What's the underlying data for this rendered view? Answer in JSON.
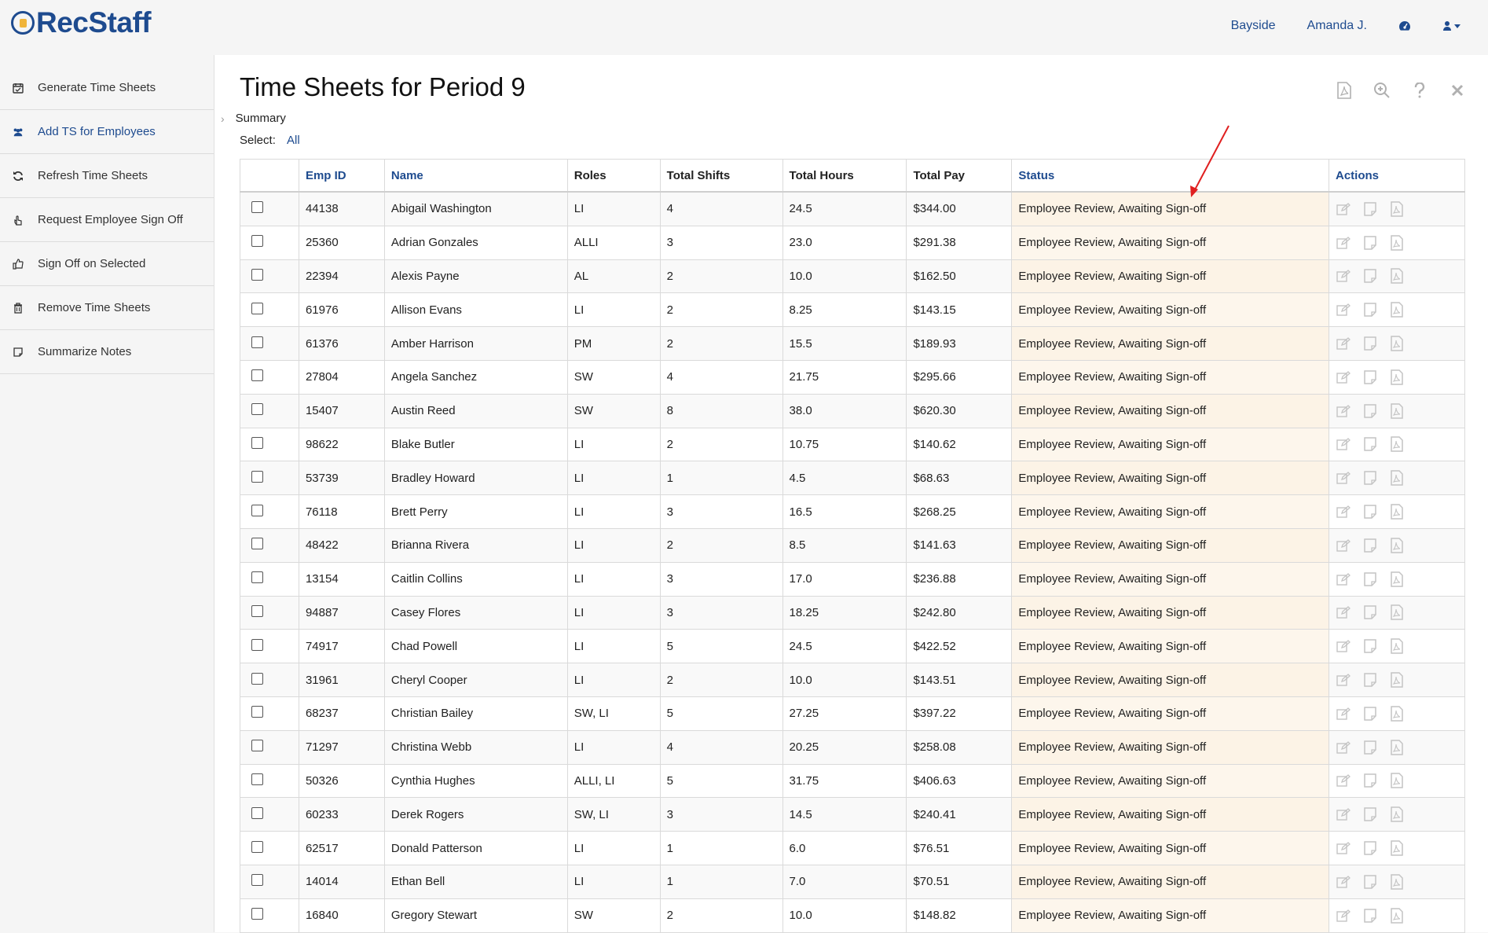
{
  "app": {
    "name": "RecStaff"
  },
  "topnav": {
    "location": "Bayside",
    "user": "Amanda J.",
    "dashboard_icon": "dashboard-icon",
    "user_icon": "user-icon"
  },
  "sidebar": {
    "items": [
      {
        "label": "Generate Time Sheets",
        "icon": "calendar-check-icon",
        "active": false
      },
      {
        "label": "Add TS for Employees",
        "icon": "users-icon",
        "active": true
      },
      {
        "label": "Refresh Time Sheets",
        "icon": "refresh-icon",
        "active": false
      },
      {
        "label": "Request Employee Sign Off",
        "icon": "hand-pointer-icon",
        "active": false
      },
      {
        "label": "Sign Off on Selected",
        "icon": "thumbs-up-icon",
        "active": false
      },
      {
        "label": "Remove Time Sheets",
        "icon": "trash-icon",
        "active": false
      },
      {
        "label": "Summarize Notes",
        "icon": "note-icon",
        "active": false
      }
    ]
  },
  "main": {
    "title": "Time Sheets for Period 9",
    "summary_label": "Summary",
    "select_label": "Select:",
    "select_all": "All"
  },
  "table": {
    "headers": {
      "emp_id": "Emp ID",
      "name": "Name",
      "roles": "Roles",
      "total_shifts": "Total Shifts",
      "total_hours": "Total Hours",
      "total_pay": "Total Pay",
      "status": "Status",
      "actions": "Actions"
    },
    "rows": [
      {
        "emp_id": "44138",
        "name": "Abigail Washington",
        "roles": "LI",
        "shifts": "4",
        "hours": "24.5",
        "pay": "$344.00",
        "status": "Employee Review, Awaiting Sign-off"
      },
      {
        "emp_id": "25360",
        "name": "Adrian Gonzales",
        "roles": "ALLI",
        "shifts": "3",
        "hours": "23.0",
        "pay": "$291.38",
        "status": "Employee Review, Awaiting Sign-off"
      },
      {
        "emp_id": "22394",
        "name": "Alexis Payne",
        "roles": "AL",
        "shifts": "2",
        "hours": "10.0",
        "pay": "$162.50",
        "status": "Employee Review, Awaiting Sign-off"
      },
      {
        "emp_id": "61976",
        "name": "Allison Evans",
        "roles": "LI",
        "shifts": "2",
        "hours": "8.25",
        "pay": "$143.15",
        "status": "Employee Review, Awaiting Sign-off"
      },
      {
        "emp_id": "61376",
        "name": "Amber Harrison",
        "roles": "PM",
        "shifts": "2",
        "hours": "15.5",
        "pay": "$189.93",
        "status": "Employee Review, Awaiting Sign-off"
      },
      {
        "emp_id": "27804",
        "name": "Angela Sanchez",
        "roles": "SW",
        "shifts": "4",
        "hours": "21.75",
        "pay": "$295.66",
        "status": "Employee Review, Awaiting Sign-off"
      },
      {
        "emp_id": "15407",
        "name": "Austin Reed",
        "roles": "SW",
        "shifts": "8",
        "hours": "38.0",
        "pay": "$620.30",
        "status": "Employee Review, Awaiting Sign-off"
      },
      {
        "emp_id": "98622",
        "name": "Blake Butler",
        "roles": "LI",
        "shifts": "2",
        "hours": "10.75",
        "pay": "$140.62",
        "status": "Employee Review, Awaiting Sign-off"
      },
      {
        "emp_id": "53739",
        "name": "Bradley Howard",
        "roles": "LI",
        "shifts": "1",
        "hours": "4.5",
        "pay": "$68.63",
        "status": "Employee Review, Awaiting Sign-off"
      },
      {
        "emp_id": "76118",
        "name": "Brett Perry",
        "roles": "LI",
        "shifts": "3",
        "hours": "16.5",
        "pay": "$268.25",
        "status": "Employee Review, Awaiting Sign-off"
      },
      {
        "emp_id": "48422",
        "name": "Brianna Rivera",
        "roles": "LI",
        "shifts": "2",
        "hours": "8.5",
        "pay": "$141.63",
        "status": "Employee Review, Awaiting Sign-off"
      },
      {
        "emp_id": "13154",
        "name": "Caitlin Collins",
        "roles": "LI",
        "shifts": "3",
        "hours": "17.0",
        "pay": "$236.88",
        "status": "Employee Review, Awaiting Sign-off"
      },
      {
        "emp_id": "94887",
        "name": "Casey Flores",
        "roles": "LI",
        "shifts": "3",
        "hours": "18.25",
        "pay": "$242.80",
        "status": "Employee Review, Awaiting Sign-off"
      },
      {
        "emp_id": "74917",
        "name": "Chad Powell",
        "roles": "LI",
        "shifts": "5",
        "hours": "24.5",
        "pay": "$422.52",
        "status": "Employee Review, Awaiting Sign-off"
      },
      {
        "emp_id": "31961",
        "name": "Cheryl Cooper",
        "roles": "LI",
        "shifts": "2",
        "hours": "10.0",
        "pay": "$143.51",
        "status": "Employee Review, Awaiting Sign-off"
      },
      {
        "emp_id": "68237",
        "name": "Christian Bailey",
        "roles": "SW, LI",
        "shifts": "5",
        "hours": "27.25",
        "pay": "$397.22",
        "status": "Employee Review, Awaiting Sign-off"
      },
      {
        "emp_id": "71297",
        "name": "Christina Webb",
        "roles": "LI",
        "shifts": "4",
        "hours": "20.25",
        "pay": "$258.08",
        "status": "Employee Review, Awaiting Sign-off"
      },
      {
        "emp_id": "50326",
        "name": "Cynthia Hughes",
        "roles": "ALLI, LI",
        "shifts": "5",
        "hours": "31.75",
        "pay": "$406.63",
        "status": "Employee Review, Awaiting Sign-off"
      },
      {
        "emp_id": "60233",
        "name": "Derek Rogers",
        "roles": "SW, LI",
        "shifts": "3",
        "hours": "14.5",
        "pay": "$240.41",
        "status": "Employee Review, Awaiting Sign-off"
      },
      {
        "emp_id": "62517",
        "name": "Donald Patterson",
        "roles": "LI",
        "shifts": "1",
        "hours": "6.0",
        "pay": "$76.51",
        "status": "Employee Review, Awaiting Sign-off"
      },
      {
        "emp_id": "14014",
        "name": "Ethan Bell",
        "roles": "LI",
        "shifts": "1",
        "hours": "7.0",
        "pay": "$70.51",
        "status": "Employee Review, Awaiting Sign-off"
      },
      {
        "emp_id": "16840",
        "name": "Gregory Stewart",
        "roles": "SW",
        "shifts": "2",
        "hours": "10.0",
        "pay": "$148.82",
        "status": "Employee Review, Awaiting Sign-off"
      }
    ]
  },
  "colors": {
    "accent": "#1e4b8f",
    "status_bg": "#fcf3e6",
    "annotation_arrow": "#e02020"
  }
}
